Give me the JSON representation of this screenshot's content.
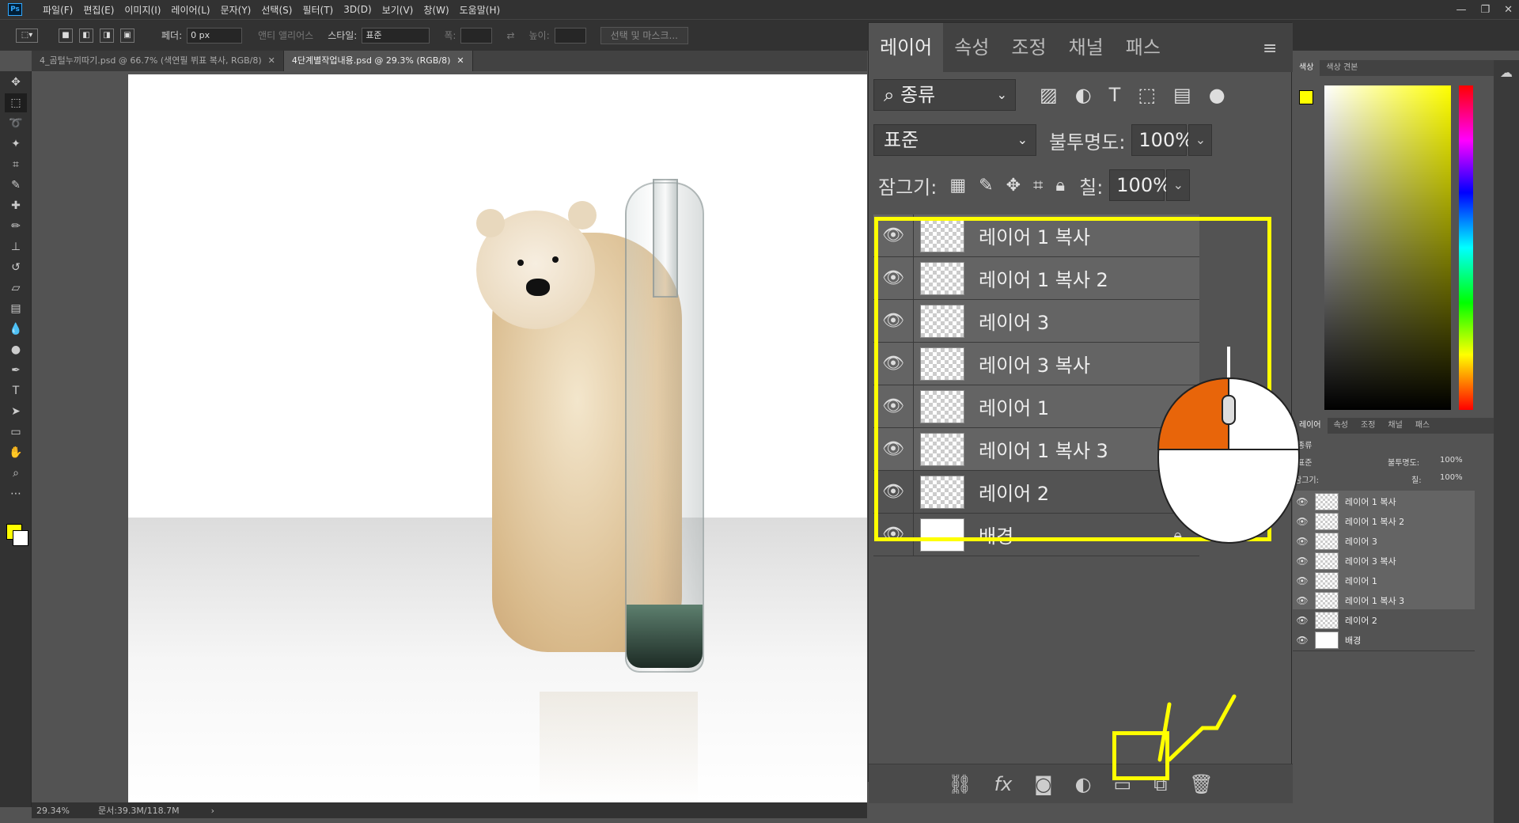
{
  "menus": [
    "파일(F)",
    "편집(E)",
    "이미지(I)",
    "레이어(L)",
    "문자(Y)",
    "선택(S)",
    "필터(T)",
    "3D(D)",
    "보기(V)",
    "창(W)",
    "도움말(H)"
  ],
  "options": {
    "feather_label": "페더:",
    "feather_value": "0 px",
    "antialias_label": "앤티 앨리어스",
    "style_label": "스타일:",
    "style_value": "표준",
    "width_label": "폭:",
    "height_label": "높이:",
    "select_mask_button": "선택 및 마스크..."
  },
  "tabs": [
    {
      "label": "4_곰털누끼따기.psd @ 66.7% (색연필 뷔표 복사, RGB/8)"
    },
    {
      "label": "4단계별작업내용.psd @ 29.3% (RGB/8)"
    }
  ],
  "status": {
    "zoom": "29.34%",
    "doc": "문서:39.3M/118.7M"
  },
  "layers_panel": {
    "tabs": [
      "레이어",
      "속성",
      "조정",
      "채널",
      "패스"
    ],
    "kind_filter": "종류",
    "blend_mode": "표준",
    "opacity_label": "불투명도:",
    "opacity_value": "100%",
    "lock_label": "잠그기:",
    "fill_label": "칠:",
    "fill_value": "100%",
    "layers": [
      {
        "name": "레이어 1 복사"
      },
      {
        "name": "레이어 1 복사 2"
      },
      {
        "name": "레이어 3"
      },
      {
        "name": "레이어 3 복사"
      },
      {
        "name": "레이어 1"
      },
      {
        "name": "레이어 1 복사 3"
      },
      {
        "name": "레이어 2"
      },
      {
        "name": "배경"
      }
    ]
  },
  "color_panel": {
    "tabs": [
      "색상",
      "색상 견본"
    ]
  },
  "mini_layers": {
    "tabs": [
      "레이어",
      "속성",
      "조정",
      "채널",
      "패스"
    ],
    "kind_filter": "종류",
    "blend_mode": "표준",
    "opacity_label": "불투명도:",
    "opacity_value": "100%",
    "lock_label": "잠그기:",
    "fill_label": "칠:",
    "fill_value": "100%"
  },
  "colors": {
    "highlight": "#ffff00",
    "mouse_button": "#e8650a",
    "foreground": "#ffff00"
  }
}
